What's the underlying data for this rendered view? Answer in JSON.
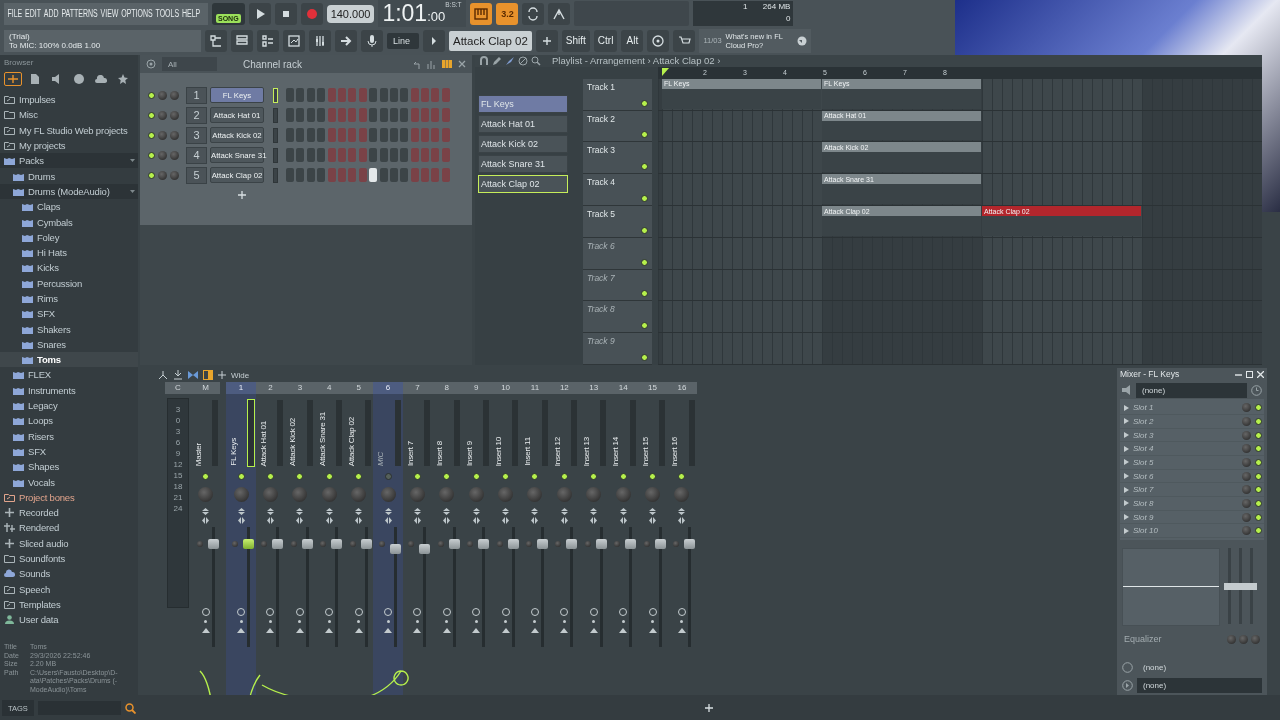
{
  "menu": [
    "FILE",
    "EDIT",
    "ADD",
    "PATTERNS",
    "VIEW",
    "OPTIONS",
    "TOOLS",
    "HELP"
  ],
  "transport": {
    "mode": "SONG",
    "song_mode": true,
    "tempo": "140.000",
    "time": "1:01",
    "time_ticks": ":00",
    "time_format": "B:S:T",
    "snap_label": "3.2"
  },
  "monitor": {
    "cpu": "1",
    "memory": "264 MB",
    "polyphony": "0"
  },
  "hint_bar": {
    "lines": [
      "(Trial)",
      "To MIC: 100% 0.0dB 1.00"
    ]
  },
  "toolbar": {
    "input": "Line",
    "pattern": "Attack Clap 02",
    "keys": [
      "Shift",
      "Ctrl",
      "Alt"
    ]
  },
  "news": {
    "date": "11/03",
    "text": "What's new in FL Cloud Pro?"
  },
  "browser": {
    "title": "Browser",
    "items": [
      {
        "label": "Impulses",
        "kind": "link",
        "selected": false
      },
      {
        "label": "Misc",
        "kind": "folder",
        "selected": false
      },
      {
        "label": "My FL Studio Web projects",
        "kind": "link",
        "selected": false
      },
      {
        "label": "My projects",
        "kind": "link",
        "selected": false
      },
      {
        "label": "Packs",
        "kind": "pack",
        "selected": false,
        "expanded": true,
        "children": [
          {
            "label": "Drums",
            "kind": "pack",
            "selected": false
          },
          {
            "label": "Drums (ModeAudio)",
            "kind": "pack",
            "selected": false,
            "expanded": true,
            "children": [
              {
                "label": "Claps",
                "kind": "pack",
                "selected": false
              },
              {
                "label": "Cymbals",
                "kind": "pack",
                "selected": false
              },
              {
                "label": "Foley",
                "kind": "pack",
                "selected": false
              },
              {
                "label": "Hi Hats",
                "kind": "pack",
                "selected": false
              },
              {
                "label": "Kicks",
                "kind": "pack",
                "selected": false
              },
              {
                "label": "Percussion",
                "kind": "pack",
                "selected": false
              },
              {
                "label": "Rims",
                "kind": "pack",
                "selected": false
              },
              {
                "label": "SFX",
                "kind": "pack",
                "selected": false
              },
              {
                "label": "Shakers",
                "kind": "pack",
                "selected": false
              },
              {
                "label": "Snares",
                "kind": "pack",
                "selected": false
              },
              {
                "label": "Toms",
                "kind": "pack",
                "selected": true
              }
            ]
          },
          {
            "label": "FLEX",
            "kind": "pack",
            "selected": false
          },
          {
            "label": "Instruments",
            "kind": "pack",
            "selected": false
          },
          {
            "label": "Legacy",
            "kind": "pack",
            "selected": false
          },
          {
            "label": "Loops",
            "kind": "pack",
            "selected": false
          },
          {
            "label": "Risers",
            "kind": "pack",
            "selected": false
          },
          {
            "label": "SFX",
            "kind": "pack",
            "selected": false
          },
          {
            "label": "Shapes",
            "kind": "pack",
            "selected": false
          },
          {
            "label": "Vocals",
            "kind": "pack",
            "selected": false
          }
        ]
      },
      {
        "label": "Project bones",
        "kind": "link",
        "selected": false,
        "color": "#e2a48c"
      },
      {
        "label": "Recorded",
        "kind": "plus",
        "selected": false
      },
      {
        "label": "Rendered",
        "kind": "render",
        "selected": false
      },
      {
        "label": "Sliced audio",
        "kind": "plus",
        "selected": false
      },
      {
        "label": "Soundfonts",
        "kind": "folder",
        "selected": false
      },
      {
        "label": "Sounds",
        "kind": "cloud",
        "selected": false
      },
      {
        "label": "Speech",
        "kind": "link",
        "selected": false
      },
      {
        "label": "Templates",
        "kind": "link",
        "selected": false
      },
      {
        "label": "User data",
        "kind": "user",
        "selected": false
      }
    ],
    "info": [
      {
        "label": "Title",
        "value": "Toms"
      },
      {
        "label": "Date",
        "value": "29/3/2026 22:52:46"
      },
      {
        "label": "Size",
        "value": "2.20 MB"
      },
      {
        "label": "Path",
        "value": "C:\\Users\\Fausto\\Desktop\\D-ata\\Patches\\Packs\\Drums (-ModeAudio)\\Toms"
      }
    ],
    "tags_button": "TAGS"
  },
  "channel_rack": {
    "title": "Channel rack",
    "filter": "All",
    "channels": [
      {
        "number": "1",
        "name": "FL Keys",
        "selected": true,
        "steps": [
          false,
          false,
          false,
          false,
          false,
          false,
          false,
          false,
          false,
          false,
          false,
          false,
          false,
          false,
          false,
          false
        ]
      },
      {
        "number": "2",
        "name": "Attack Hat 01",
        "selected": false,
        "steps": [
          false,
          false,
          false,
          false,
          false,
          false,
          false,
          false,
          false,
          false,
          false,
          false,
          false,
          false,
          false,
          false
        ]
      },
      {
        "number": "3",
        "name": "Attack Kick 02",
        "selected": false,
        "steps": [
          false,
          false,
          false,
          false,
          false,
          false,
          false,
          false,
          false,
          false,
          false,
          false,
          false,
          false,
          false,
          false
        ]
      },
      {
        "number": "4",
        "name": "Attack Snare 31",
        "selected": false,
        "steps": [
          false,
          false,
          false,
          false,
          false,
          false,
          false,
          false,
          false,
          false,
          false,
          false,
          false,
          false,
          false,
          false
        ]
      },
      {
        "number": "5",
        "name": "Attack Clap 02",
        "selected": false,
        "steps": [
          false,
          false,
          false,
          false,
          false,
          false,
          false,
          false,
          true,
          false,
          false,
          false,
          false,
          false,
          false,
          false
        ]
      }
    ]
  },
  "playlist": {
    "title": "Playlist - Arrangement › Attack Clap 02 ›",
    "ruler": [
      "2",
      "3",
      "4",
      "5",
      "6",
      "7",
      "8"
    ],
    "patterns": [
      {
        "name": "FL Keys",
        "selected": true,
        "current": false
      },
      {
        "name": "Attack Hat 01",
        "selected": false,
        "current": false
      },
      {
        "name": "Attack Kick 02",
        "selected": false,
        "current": false
      },
      {
        "name": "Attack Snare 31",
        "selected": false,
        "current": false
      },
      {
        "name": "Attack Clap 02",
        "selected": false,
        "current": true
      }
    ],
    "tracks": [
      {
        "name": "Track 1",
        "dimmed": false,
        "slots": [
          {
            "kind": "clip",
            "label": "FL Keys",
            "selected": false
          },
          {
            "kind": "clip",
            "label": "FL Keys",
            "selected": false
          }
        ]
      },
      {
        "name": "Track 2",
        "dimmed": false,
        "slots": [
          {
            "kind": "empty"
          },
          {
            "kind": "clip",
            "label": "Attack Hat 01",
            "selected": false
          }
        ]
      },
      {
        "name": "Track 3",
        "dimmed": false,
        "slots": [
          {
            "kind": "empty"
          },
          {
            "kind": "clip",
            "label": "Attack Kick 02",
            "selected": false
          }
        ]
      },
      {
        "name": "Track 4",
        "dimmed": false,
        "slots": [
          {
            "kind": "empty"
          },
          {
            "kind": "clip",
            "label": "Attack Snare 31",
            "selected": false
          }
        ]
      },
      {
        "name": "Track 5",
        "dimmed": false,
        "slots": [
          {
            "kind": "empty"
          },
          {
            "kind": "clip",
            "label": "Attack Clap 02",
            "selected": false
          },
          {
            "kind": "clip",
            "label": "Attack Clap 02",
            "selected": true
          }
        ]
      },
      {
        "name": "Track 6",
        "dimmed": true
      },
      {
        "name": "Track 7",
        "dimmed": true
      },
      {
        "name": "Track 8",
        "dimmed": true
      },
      {
        "name": "Track 9",
        "dimmed": true
      }
    ]
  },
  "mixer": {
    "preset": "Wide",
    "current_label": "C",
    "scale": [
      "3",
      "0",
      "3",
      "6",
      "9",
      "12",
      "15",
      "18",
      "21",
      "24"
    ],
    "tracks": [
      {
        "number": "M",
        "name": "Master",
        "selected": false,
        "enabled": true,
        "level": 0.86
      },
      {
        "number": "1",
        "name": "FL Keys",
        "selected": true,
        "enabled": true,
        "level": 0.86
      },
      {
        "number": "2",
        "name": "Attack Hat 01",
        "selected": false,
        "enabled": true,
        "level": 0.86
      },
      {
        "number": "3",
        "name": "Attack Kick 02",
        "selected": false,
        "enabled": true,
        "level": 0.86
      },
      {
        "number": "4",
        "name": "Attack Snare 31",
        "selected": false,
        "enabled": true,
        "level": 0.86
      },
      {
        "number": "5",
        "name": "Attack Clap 02",
        "selected": false,
        "enabled": true,
        "level": 0.86
      },
      {
        "number": "6",
        "name": "MIC",
        "selected": true,
        "enabled": false,
        "level": 0.82
      },
      {
        "number": "7",
        "name": "Insert 7",
        "selected": false,
        "enabled": true,
        "level": 0.82
      },
      {
        "number": "8",
        "name": "Insert 8",
        "selected": false,
        "enabled": true,
        "level": 0.86
      },
      {
        "number": "9",
        "name": "Insert 9",
        "selected": false,
        "enabled": true,
        "level": 0.86
      },
      {
        "number": "10",
        "name": "Insert 10",
        "selected": false,
        "enabled": true,
        "level": 0.86
      },
      {
        "number": "11",
        "name": "Insert 11",
        "selected": false,
        "enabled": true,
        "level": 0.86
      },
      {
        "number": "12",
        "name": "Insert 12",
        "selected": false,
        "enabled": true,
        "level": 0.86
      },
      {
        "number": "13",
        "name": "Insert 13",
        "selected": false,
        "enabled": true,
        "level": 0.86
      },
      {
        "number": "14",
        "name": "Insert 14",
        "selected": false,
        "enabled": true,
        "level": 0.86
      },
      {
        "number": "15",
        "name": "Insert 15",
        "selected": false,
        "enabled": true,
        "level": 0.86
      },
      {
        "number": "16",
        "name": "Insert 16",
        "selected": false,
        "enabled": true,
        "level": 0.86
      }
    ]
  },
  "mixer_panel": {
    "title": "Mixer - FL Keys",
    "input": "(none)",
    "slots": [
      "Slot 1",
      "Slot 2",
      "Slot 3",
      "Slot 4",
      "Slot 5",
      "Slot 6",
      "Slot 7",
      "Slot 8",
      "Slot 9",
      "Slot 10"
    ],
    "eq_label": "Equalizer",
    "eq_bands": [
      {
        "level": 0.5
      },
      {
        "level": 0.5
      },
      {
        "level": 0.5
      }
    ],
    "send": "(none)",
    "output": "(none)"
  }
}
